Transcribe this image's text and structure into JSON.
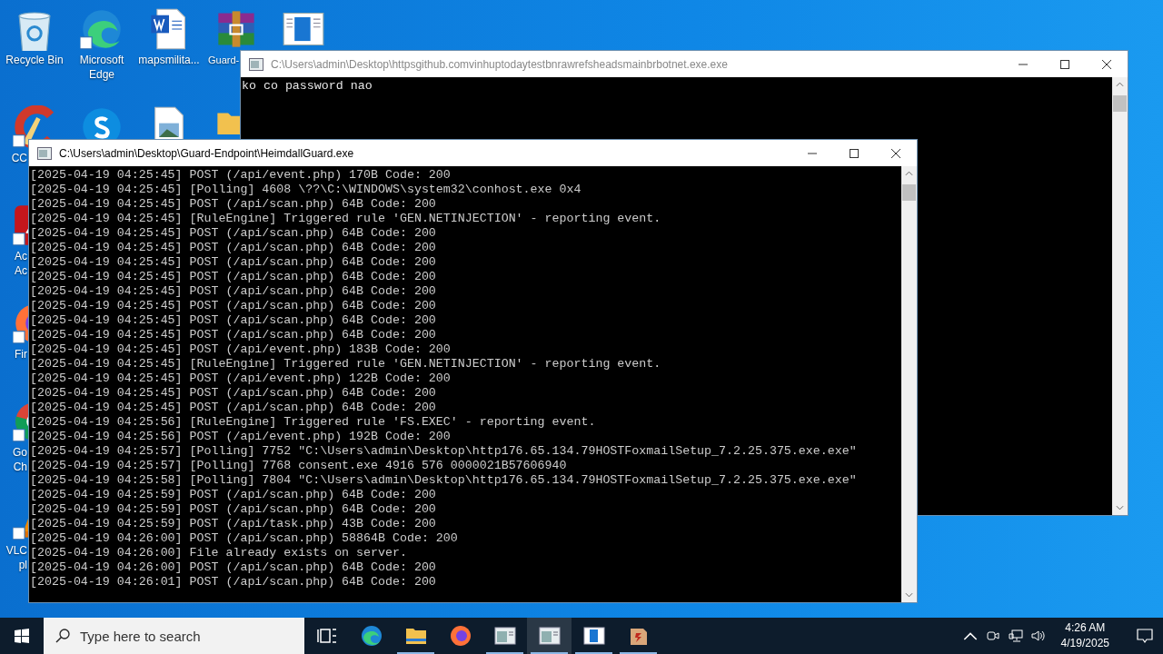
{
  "desktop_icons": [
    {
      "kind": "recycle-bin",
      "label": "Recycle Bin"
    },
    {
      "kind": "ccleaner",
      "label": "CC"
    },
    {
      "kind": "acrobat",
      "label": "Ac\nAc"
    },
    {
      "kind": "firefox",
      "label": "Fir"
    },
    {
      "kind": "chrome",
      "label": "Go\nCh"
    },
    {
      "kind": "vlc",
      "label": "VLC\npl"
    },
    {
      "kind": "edge",
      "label": "Microsoft Edge"
    },
    {
      "kind": "skype"
    },
    {
      "kind": "word",
      "label": "mapsmilita..."
    },
    {
      "kind": "image"
    },
    {
      "kind": "winrar",
      "label": "Guard-"
    },
    {
      "kind": "folder"
    },
    {
      "kind": "window"
    }
  ],
  "windows": [
    {
      "title": "C:\\Users\\admin\\Desktop\\httpsgithub.comvinhuptodaytestbnrawrefsheadsmainbrbotnet.exe.exe",
      "active": false,
      "lines": [
        "ko co password nao"
      ]
    },
    {
      "title": "C:\\Users\\admin\\Desktop\\Guard-Endpoint\\HeimdallGuard.exe",
      "active": true,
      "lines": [
        "[2025-04-19 04:25:45] POST (/api/event.php) 170B Code: 200",
        "[2025-04-19 04:25:45] [Polling] 4608 \\??\\C:\\WINDOWS\\system32\\conhost.exe 0x4",
        "[2025-04-19 04:25:45] POST (/api/scan.php) 64B Code: 200",
        "[2025-04-19 04:25:45] [RuleEngine] Triggered rule 'GEN.NETINJECTION' - reporting event.",
        "[2025-04-19 04:25:45] POST (/api/scan.php) 64B Code: 200",
        "[2025-04-19 04:25:45] POST (/api/scan.php) 64B Code: 200",
        "[2025-04-19 04:25:45] POST (/api/scan.php) 64B Code: 200",
        "[2025-04-19 04:25:45] POST (/api/scan.php) 64B Code: 200",
        "[2025-04-19 04:25:45] POST (/api/scan.php) 64B Code: 200",
        "[2025-04-19 04:25:45] POST (/api/scan.php) 64B Code: 200",
        "[2025-04-19 04:25:45] POST (/api/scan.php) 64B Code: 200",
        "[2025-04-19 04:25:45] POST (/api/scan.php) 64B Code: 200",
        "[2025-04-19 04:25:45] POST (/api/event.php) 183B Code: 200",
        "[2025-04-19 04:25:45] [RuleEngine] Triggered rule 'GEN.NETINJECTION' - reporting event.",
        "[2025-04-19 04:25:45] POST (/api/event.php) 122B Code: 200",
        "[2025-04-19 04:25:45] POST (/api/scan.php) 64B Code: 200",
        "[2025-04-19 04:25:45] POST (/api/scan.php) 64B Code: 200",
        "[2025-04-19 04:25:56] [RuleEngine] Triggered rule 'FS.EXEC' - reporting event.",
        "[2025-04-19 04:25:56] POST (/api/event.php) 192B Code: 200",
        "[2025-04-19 04:25:57] [Polling] 7752 \"C:\\Users\\admin\\Desktop\\http176.65.134.79HOSTFoxmailSetup_7.2.25.375.exe.exe\"",
        "[2025-04-19 04:25:57] [Polling] 7768 consent.exe 4916 576 0000021B57606940",
        "[2025-04-19 04:25:58] [Polling] 7804 \"C:\\Users\\admin\\Desktop\\http176.65.134.79HOSTFoxmailSetup_7.2.25.375.exe.exe\"",
        "[2025-04-19 04:25:59] POST (/api/scan.php) 64B Code: 200",
        "[2025-04-19 04:25:59] POST (/api/scan.php) 64B Code: 200",
        "[2025-04-19 04:25:59] POST (/api/task.php) 43B Code: 200",
        "[2025-04-19 04:26:00] POST (/api/scan.php) 58864B Code: 200",
        "[2025-04-19 04:26:00] File already exists on server.",
        "[2025-04-19 04:26:00] POST (/api/scan.php) 64B Code: 200",
        "[2025-04-19 04:26:01] POST (/api/scan.php) 64B Code: 200"
      ]
    }
  ],
  "taskbar": {
    "search_placeholder": "Type here to search",
    "apps": [
      {
        "kind": "task-view",
        "running": false,
        "selected": false
      },
      {
        "kind": "edge",
        "running": false,
        "selected": false
      },
      {
        "kind": "folder",
        "running": true,
        "selected": false
      },
      {
        "kind": "firefox",
        "running": false,
        "selected": false
      },
      {
        "kind": "console",
        "running": true,
        "selected": false
      },
      {
        "kind": "console",
        "running": true,
        "selected": true
      },
      {
        "kind": "window",
        "running": true,
        "selected": false
      },
      {
        "kind": "app",
        "running": true,
        "selected": false
      }
    ],
    "time": "4:26 AM",
    "date": "4/19/2025"
  }
}
